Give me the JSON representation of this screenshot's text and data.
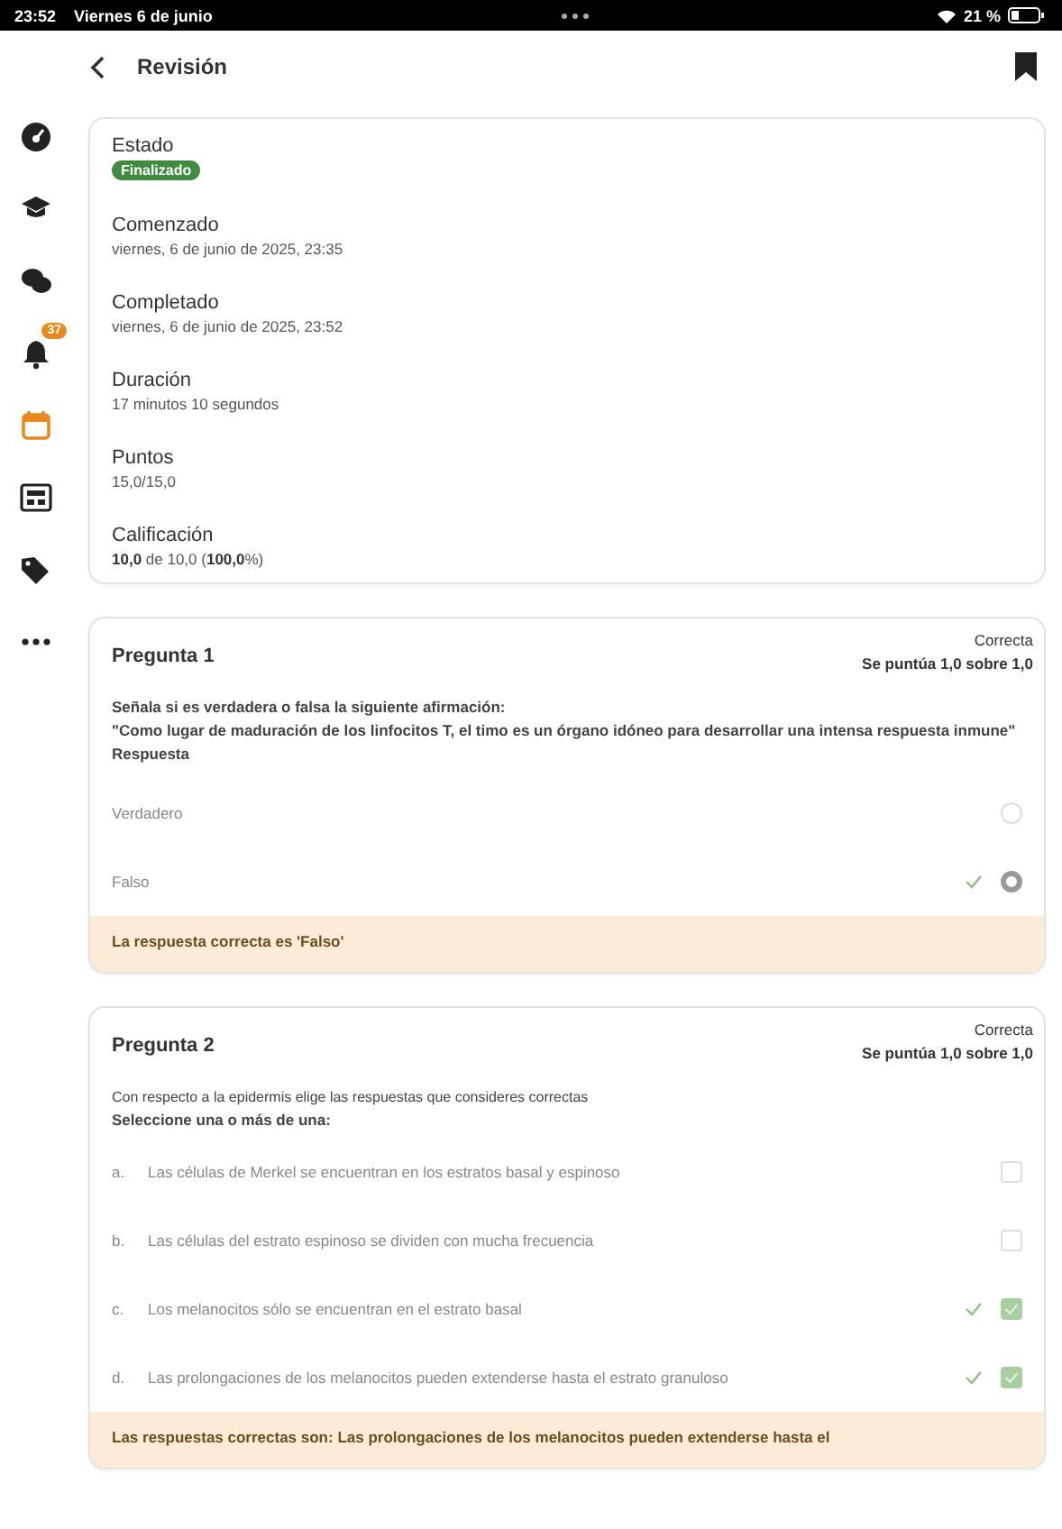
{
  "status_bar": {
    "time": "23:52",
    "date": "Viernes 6 de junio",
    "battery": "21 %"
  },
  "header": {
    "title": "Revisión"
  },
  "sidebar": {
    "items": [
      {
        "kind": "gauge",
        "selected": false
      },
      {
        "kind": "cap",
        "selected": false
      },
      {
        "kind": "chat",
        "selected": false
      },
      {
        "kind": "bell",
        "selected": false,
        "badge": "37"
      },
      {
        "kind": "calendar",
        "selected": true
      },
      {
        "kind": "news",
        "selected": false
      },
      {
        "kind": "tags",
        "selected": false
      },
      {
        "kind": "more",
        "selected": false
      }
    ]
  },
  "summary": [
    {
      "label": "Estado",
      "kind": "badge",
      "value": "Finalizado"
    },
    {
      "label": "Comenzado",
      "kind": "text",
      "value": "viernes, 6 de junio de 2025, 23:35"
    },
    {
      "label": "Completado",
      "kind": "text",
      "value": "viernes, 6 de junio de 2025, 23:52"
    },
    {
      "label": "Duración",
      "kind": "text",
      "value": "17 minutos 10 segundos"
    },
    {
      "label": "Puntos",
      "kind": "text",
      "value": "15,0/15,0"
    },
    {
      "label": "Calificación",
      "kind": "text",
      "value": "**10,0** de 10,0 (**100,0**%)"
    }
  ],
  "questions": [
    {
      "title": "Pregunta 1",
      "status": "Correcta",
      "score": "Se puntúa 1,0 sobre 1,0",
      "prompt": [
        {
          "kind": "bold",
          "text": "Señala si es verdadera o falsa la siguiente afirmación:"
        },
        {
          "kind": "bold",
          "text": "\"Como lugar de maduración de los linfocitos T, el timo es un órgano idóneo para desarrollar una intensa respuesta inmune\""
        },
        {
          "kind": "bold",
          "text": "Respuesta"
        }
      ],
      "options": [
        {
          "kind": "radio",
          "label": "Verdadero",
          "selected": false,
          "correct": false
        },
        {
          "kind": "radio",
          "label": "Falso",
          "selected": true,
          "correct": true
        }
      ],
      "feedback": "La respuesta correcta es 'Falso'"
    },
    {
      "title": "Pregunta 2",
      "status": "Correcta",
      "score": "Se puntúa 1,0 sobre 1,0",
      "prompt": [
        {
          "kind": "plain",
          "text": "Con respecto a la epidermis elige las respuestas que consideres correctas"
        },
        {
          "kind": "bold",
          "text": "Seleccione una o más de una:"
        }
      ],
      "options": [
        {
          "kind": "checkbox",
          "letter": "a.",
          "label": "Las células de Merkel se encuentran en los estratos basal y espinoso",
          "selected": false,
          "correct": false
        },
        {
          "kind": "checkbox",
          "letter": "b.",
          "label": "Las células del estrato espinoso se dividen con mucha frecuencia",
          "selected": false,
          "correct": false
        },
        {
          "kind": "checkbox",
          "letter": "c.",
          "label": "Los melanocitos sólo se encuentran en el estrato basal",
          "selected": true,
          "correct": true
        },
        {
          "kind": "checkbox",
          "letter": "d.",
          "label": "Las prolongaciones de los melanocitos pueden extenderse hasta el estrato granuloso",
          "selected": true,
          "correct": true
        }
      ],
      "feedback": "Las respuestas correctas son: Las prolongaciones de los melanocitos pueden extenderse hasta el"
    }
  ]
}
